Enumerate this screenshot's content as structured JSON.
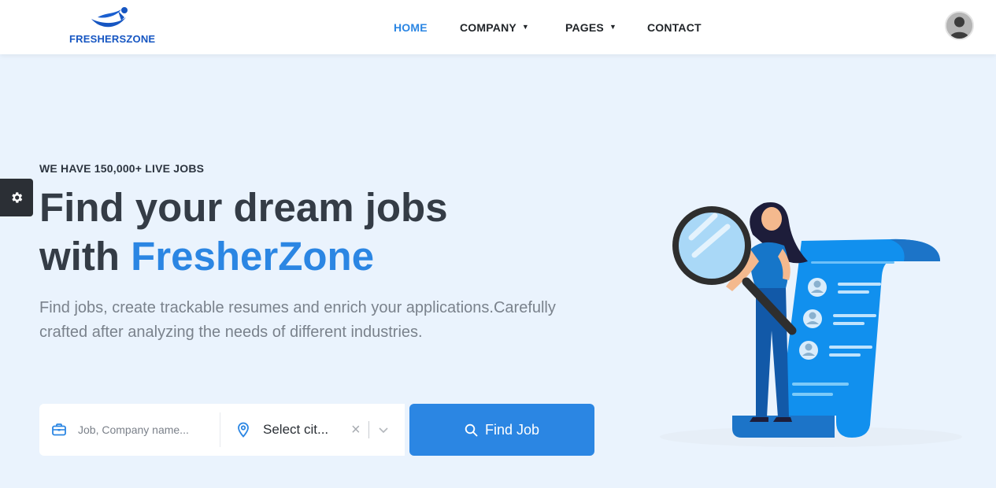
{
  "brand": {
    "name": "FRESHERSZONE",
    "color": "#1656c2"
  },
  "nav": {
    "items": [
      {
        "label": "HOME",
        "active": true
      },
      {
        "label": "COMPANY",
        "has_dropdown": true
      },
      {
        "label": "PAGES",
        "has_dropdown": true
      },
      {
        "label": "CONTACT"
      }
    ]
  },
  "settings": {
    "icon": "gear-icon"
  },
  "hero": {
    "eyebrow": "WE HAVE 150,000+ LIVE JOBS",
    "headline_line1": "Find your dream jobs",
    "headline_prefix": "with ",
    "headline_highlight": "FresherZone",
    "subtext": "Find jobs, create trackable resumes and enrich your applications.Carefully crafted after analyzing the needs of different industries."
  },
  "search": {
    "job_placeholder": "Job, Company name...",
    "job_icon": "briefcase-icon",
    "city_value": "Select cit...",
    "city_icon": "map-pin-icon",
    "button_label": "Find Job",
    "button_icon": "search-icon"
  },
  "colors": {
    "accent": "#2b86e3",
    "background": "#eaf3fd",
    "heading": "#343c46",
    "muted_text": "#7a828c"
  }
}
